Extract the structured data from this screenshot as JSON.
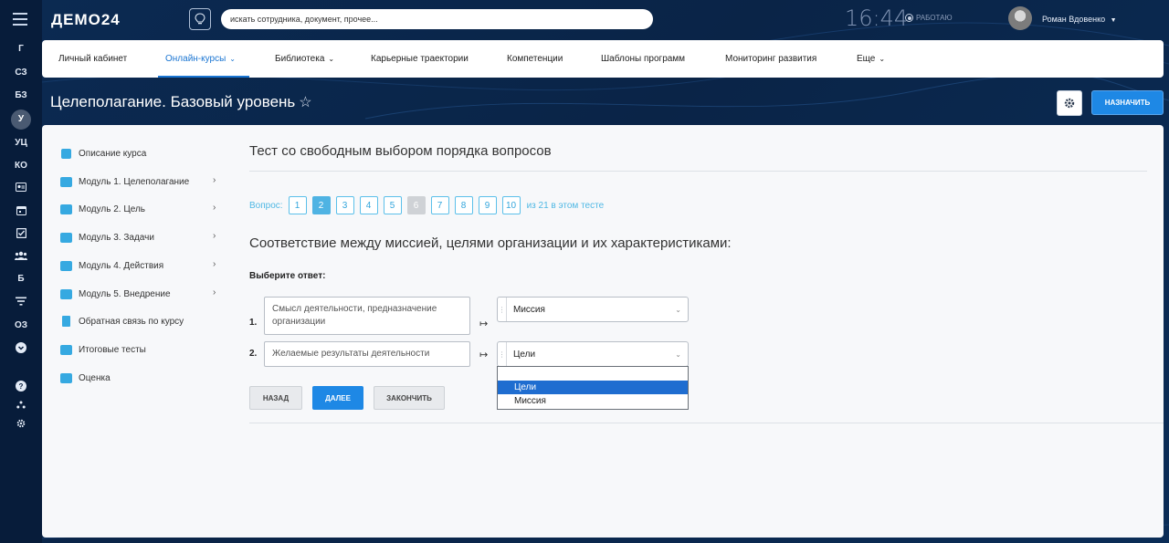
{
  "app": {
    "logo": "ДЕМО24",
    "search_placeholder": "искать сотрудника, документ, прочее...",
    "clock": "16:44",
    "status": "РАБОТАЮ",
    "user_name": "Роман Вдовенко",
    "colors": {
      "accent": "#1e88e5",
      "rail": "#071c3a",
      "link": "#1a75d2"
    }
  },
  "rail": {
    "items": [
      "Г",
      "СЗ",
      "БЗ",
      "У",
      "УЦ",
      "КО"
    ],
    "items2": [
      "Б"
    ],
    "items3": [
      "ОЗ"
    ],
    "icons": [
      "id-card-icon",
      "calendar-icon",
      "checkbox-icon",
      "people-icon",
      "filter-icon",
      "chevron-circle-icon",
      "help-icon",
      "network-icon",
      "settings-icon"
    ]
  },
  "nav": {
    "tabs": [
      {
        "label": "Личный кабинет"
      },
      {
        "label": "Онлайн-курсы",
        "chevron": "⌄"
      },
      {
        "label": "Библиотека",
        "chevron": "⌄"
      },
      {
        "label": "Карьерные траектории"
      },
      {
        "label": "Компетенции"
      },
      {
        "label": "Шаблоны программ"
      },
      {
        "label": "Мониторинг развития"
      },
      {
        "label": "Еще",
        "chevron": "⌄"
      }
    ]
  },
  "page": {
    "title": "Целеполагание. Базовый уровень",
    "star": "☆",
    "assign_label": "НАЗНАЧИТЬ"
  },
  "sidebar": {
    "items": [
      {
        "label": "Описание курса"
      },
      {
        "label": "Модуль 1. Целеполагание",
        "chevron": "›"
      },
      {
        "label": "Модуль 2. Цель",
        "chevron": "›"
      },
      {
        "label": "Модуль 3. Задачи",
        "chevron": "›"
      },
      {
        "label": "Модуль 4. Действия",
        "chevron": "›"
      },
      {
        "label": "Модуль 5. Внедрение",
        "chevron": "›"
      },
      {
        "label": "Обратная связь по курсу"
      },
      {
        "label": "Итоговые тесты"
      },
      {
        "label": "Оценка"
      }
    ]
  },
  "test": {
    "title": "Тест со свободным выбором порядка вопросов",
    "question_label": "Вопрос:",
    "question_numbers": [
      "1",
      "2",
      "3",
      "4",
      "5",
      "6",
      "7",
      "8",
      "9",
      "10"
    ],
    "current_question": "2",
    "disabled_question": "6",
    "total_text": "из 21 в этом тесте",
    "question_text": "Соответствие между миссией, целями организации и их характеристиками:",
    "choose_label": "Выберите ответ:",
    "pairs": [
      {
        "num": "1.",
        "source": "Смысл деятельности, предназначение организации",
        "arrow": "↦",
        "selected": "Миссия"
      },
      {
        "num": "2.",
        "source": "Желаемые результаты деятельности",
        "arrow": "↦",
        "selected": "Цели"
      }
    ],
    "dropdown_options": [
      "",
      "Цели",
      "Миссия"
    ],
    "dropdown_highlighted": "Цели",
    "buttons": {
      "back": "НАЗАД",
      "next": "ДАЛЕЕ",
      "finish": "ЗАКОНЧИТЬ"
    }
  }
}
